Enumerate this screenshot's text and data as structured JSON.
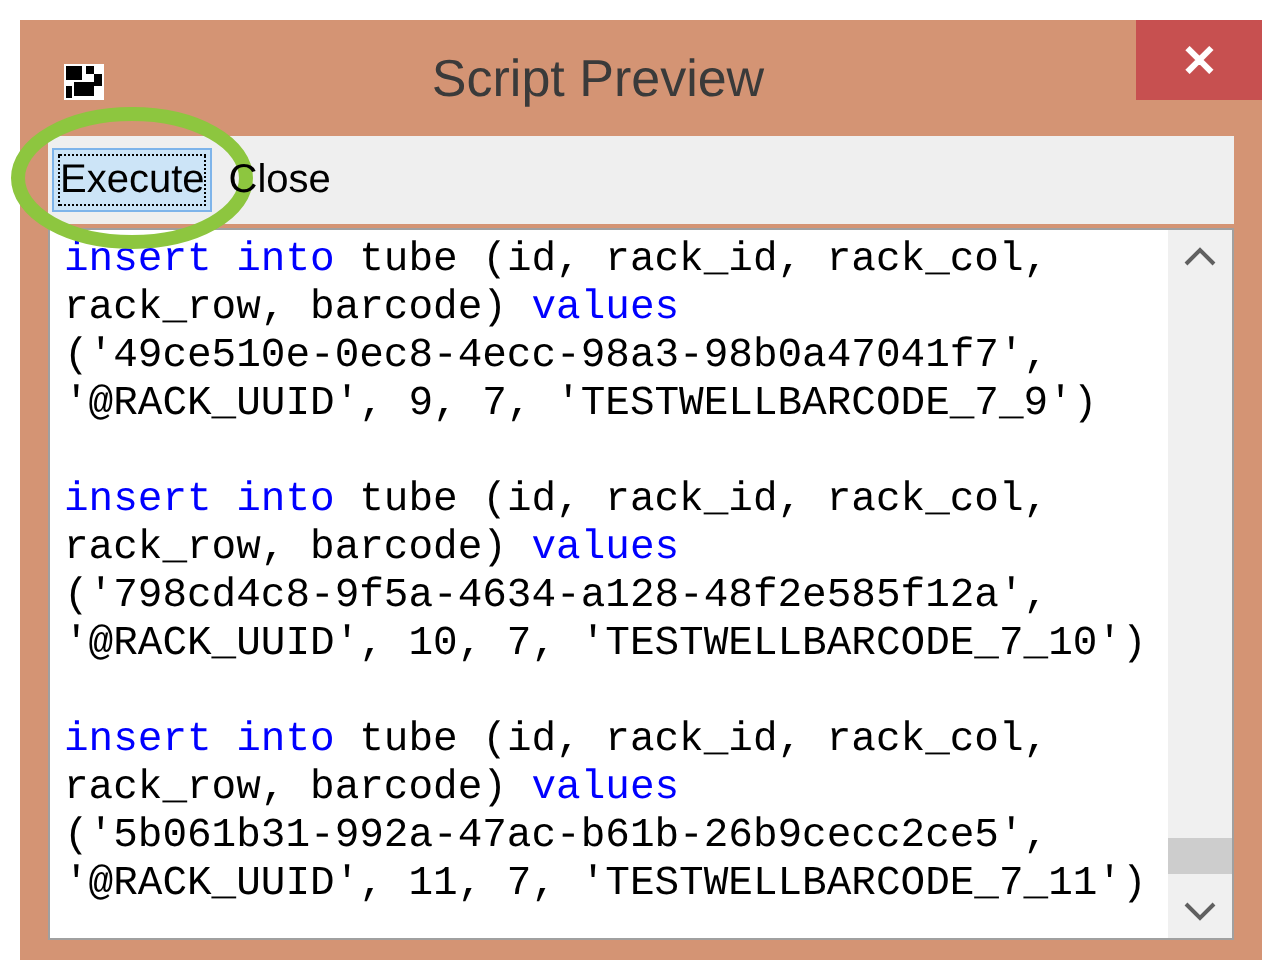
{
  "window": {
    "title": "Script Preview",
    "close_label": "✕"
  },
  "menu": [
    {
      "label": "Execute",
      "selected": true,
      "highlighted": true
    },
    {
      "label": "Close",
      "selected": false,
      "highlighted": false
    }
  ],
  "statements": [
    {
      "lines": [
        [
          {
            "kind": "keyword",
            "text": "insert"
          },
          {
            "kind": "keyword",
            "text": "into"
          },
          {
            "kind": "plain",
            "text": "tube (id, rack_id, rack_col,"
          }
        ],
        [
          {
            "kind": "plain",
            "text": "rack_row, barcode)"
          },
          {
            "kind": "keyword",
            "text": "values"
          }
        ],
        [
          {
            "kind": "plain",
            "text": "('49ce510e-0ec8-4ecc-98a3-98b0a47041f7',"
          }
        ],
        [
          {
            "kind": "plain",
            "text": "'@RACK_UUID', 9, 7, 'TESTWELLBARCODE_7_9')"
          }
        ]
      ]
    },
    {
      "lines": [
        [
          {
            "kind": "keyword",
            "text": "insert"
          },
          {
            "kind": "keyword",
            "text": "into"
          },
          {
            "kind": "plain",
            "text": "tube (id, rack_id, rack_col,"
          }
        ],
        [
          {
            "kind": "plain",
            "text": "rack_row, barcode)"
          },
          {
            "kind": "keyword",
            "text": "values"
          }
        ],
        [
          {
            "kind": "plain",
            "text": "('798cd4c8-9f5a-4634-a128-48f2e585f12a',"
          }
        ],
        [
          {
            "kind": "plain",
            "text": "'@RACK_UUID', 10, 7, 'TESTWELLBARCODE_7_10')"
          }
        ]
      ]
    },
    {
      "lines": [
        [
          {
            "kind": "keyword",
            "text": "insert"
          },
          {
            "kind": "keyword",
            "text": "into"
          },
          {
            "kind": "plain",
            "text": "tube (id, rack_id, rack_col,"
          }
        ],
        [
          {
            "kind": "plain",
            "text": "rack_row, barcode)"
          },
          {
            "kind": "keyword",
            "text": "values"
          }
        ],
        [
          {
            "kind": "plain",
            "text": "('5b061b31-992a-47ac-b61b-26b9cecc2ce5',"
          }
        ],
        [
          {
            "kind": "plain",
            "text": "'@RACK_UUID', 11, 7, 'TESTWELLBARCODE_7_11')"
          }
        ]
      ]
    }
  ]
}
